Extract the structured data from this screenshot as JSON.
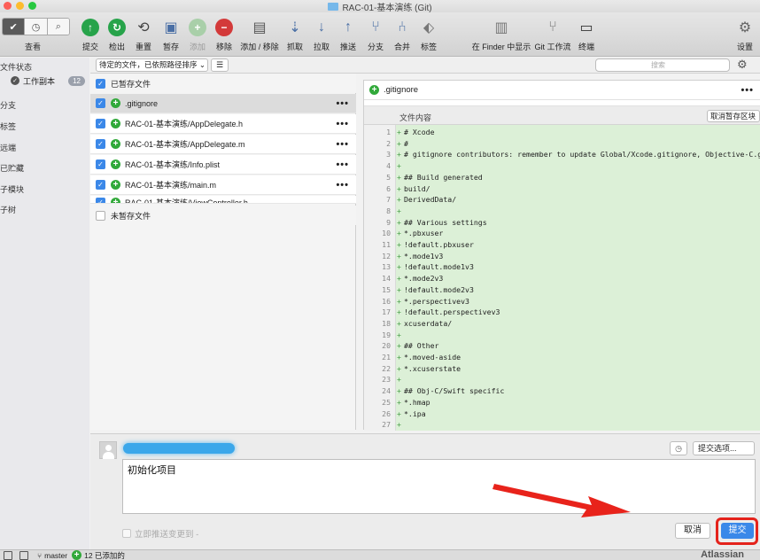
{
  "window": {
    "title": "RAC-01-基本演练 (Git)"
  },
  "toolbar": {
    "view_label": "查看",
    "buttons": [
      {
        "label": "提交",
        "color": "#27a34a"
      },
      {
        "label": "检出",
        "color": "#27a34a"
      },
      {
        "label": "重置",
        "color": "#555555"
      },
      {
        "label": "暂存",
        "color": "#4a6fa5"
      },
      {
        "label": "添加",
        "color": "#9a9a9a"
      },
      {
        "label": "移除",
        "color": "#d33a3a"
      },
      {
        "label": "添加 / 移除",
        "color": "#555555"
      },
      {
        "label": "抓取",
        "color": "#4a6fa5"
      },
      {
        "label": "拉取",
        "color": "#4a6fa5"
      },
      {
        "label": "推送",
        "color": "#4a6fa5"
      },
      {
        "label": "分支",
        "color": "#4a6fa5"
      },
      {
        "label": "合并",
        "color": "#4a6fa5"
      },
      {
        "label": "标签",
        "color": "#777777"
      },
      {
        "label": "在 Finder 中显示",
        "color": "#777777"
      },
      {
        "label": "Git 工作流",
        "color": "#777777"
      },
      {
        "label": "终端",
        "color": "#333333"
      },
      {
        "label": "设置",
        "color": "#666666"
      }
    ]
  },
  "sidebar": {
    "file_status": "文件状态",
    "working_copy": "工作副本",
    "working_copy_count": "12",
    "sections": [
      "分支",
      "标签",
      "远端",
      "已贮藏",
      "子模块",
      "子树"
    ]
  },
  "filter": {
    "sort": "待定的文件，已依照路径排序 ⌄",
    "search_placeholder": "搜索"
  },
  "filelist": {
    "staged_header": "已暂存文件",
    "unstaged_header": "未暂存文件",
    "files": [
      ".gitignore",
      "RAC-01-基本演练/AppDelegate.h",
      "RAC-01-基本演练/AppDelegate.m",
      "RAC-01-基本演练/Info.plist",
      "RAC-01-基本演练/main.m",
      "RAC-01-基本演练/ViewController.h"
    ]
  },
  "diff": {
    "filename": ".gitignore",
    "content_label": "文件内容",
    "discard_label": "取消暂存区块",
    "lines": [
      "# Xcode",
      "#",
      "# gitignore contributors: remember to update Global/Xcode.gitignore, Objective-C.gitignore",
      "",
      "## Build generated",
      "build/",
      "DerivedData/",
      "",
      "## Various settings",
      "*.pbxuser",
      "!default.pbxuser",
      "*.mode1v3",
      "!default.mode1v3",
      "*.mode2v3",
      "!default.mode2v3",
      "*.perspectivev3",
      "!default.perspectivev3",
      "xcuserdata/",
      "",
      "## Other",
      "*.moved-aside",
      "*.xcuserstate",
      "",
      "## Obj-C/Swift specific",
      "*.hmap",
      "*.ipa",
      ""
    ]
  },
  "commit": {
    "message": "初始化项目",
    "options_label": "提交选项...",
    "push_label": "立即推送变更到 -",
    "cancel_label": "取消",
    "commit_label": "提交",
    "highlight_color": "#e4231c"
  },
  "status": {
    "branch": "master",
    "added": "12 已添加的",
    "brand": "Atlassian"
  }
}
